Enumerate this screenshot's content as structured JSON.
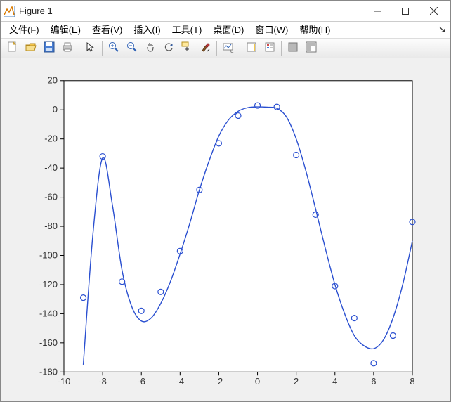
{
  "window": {
    "title": "Figure 1"
  },
  "menubar": [
    {
      "label": "文件",
      "mn": "F"
    },
    {
      "label": "编辑",
      "mn": "E"
    },
    {
      "label": "查看",
      "mn": "V"
    },
    {
      "label": "插入",
      "mn": "I"
    },
    {
      "label": "工具",
      "mn": "T"
    },
    {
      "label": "桌面",
      "mn": "D"
    },
    {
      "label": "窗口",
      "mn": "W"
    },
    {
      "label": "帮助",
      "mn": "H"
    }
  ],
  "toolbar": [
    {
      "name": "new",
      "kind": "new"
    },
    {
      "name": "open",
      "kind": "open"
    },
    {
      "name": "save",
      "kind": "save"
    },
    {
      "name": "print",
      "kind": "print"
    },
    {
      "sep": true
    },
    {
      "name": "pointer",
      "kind": "pointer"
    },
    {
      "sep": true
    },
    {
      "name": "zoom-in",
      "kind": "zoomin"
    },
    {
      "name": "zoom-out",
      "kind": "zoomout"
    },
    {
      "name": "pan",
      "kind": "pan"
    },
    {
      "name": "rotate",
      "kind": "rotate"
    },
    {
      "name": "data-cursor",
      "kind": "datacursor"
    },
    {
      "name": "brush",
      "kind": "brush"
    },
    {
      "sep": true
    },
    {
      "name": "link-plot",
      "kind": "link"
    },
    {
      "sep": true
    },
    {
      "name": "colorbar",
      "kind": "colorbar"
    },
    {
      "name": "legend",
      "kind": "legend"
    },
    {
      "sep": true
    },
    {
      "name": "dock",
      "kind": "dock"
    },
    {
      "name": "layout",
      "kind": "layout"
    }
  ],
  "chart_data": {
    "type": "line+scatter",
    "xlabel": "",
    "ylabel": "",
    "xlim": [
      -10,
      8
    ],
    "ylim": [
      -180,
      20
    ],
    "xticks": [
      -10,
      -8,
      -6,
      -4,
      -2,
      0,
      2,
      4,
      6,
      8
    ],
    "yticks": [
      -180,
      -160,
      -140,
      -120,
      -100,
      -80,
      -60,
      -40,
      -20,
      0,
      20
    ],
    "scatter": {
      "x": [
        -9,
        -8,
        -7,
        -6,
        -5,
        -4,
        -3,
        -2,
        -1,
        0,
        1,
        2,
        3,
        4,
        5,
        6,
        7,
        8
      ],
      "y": [
        -129,
        -32,
        -118,
        -138,
        -125,
        -97,
        -55,
        -23,
        -4,
        3,
        2,
        -31,
        -72,
        -121,
        -143,
        -174,
        -155,
        -77
      ]
    },
    "line": {
      "x": [
        -9,
        -8.5,
        -8,
        -7.5,
        -7,
        -6.5,
        -6,
        -5.5,
        -5,
        -4.5,
        -4,
        -3.5,
        -3,
        -2.5,
        -2,
        -1.5,
        -1,
        -0.5,
        0,
        0.5,
        1,
        1.5,
        2,
        2.5,
        3,
        3.5,
        4,
        4.5,
        5,
        5.5,
        6,
        6.5,
        7,
        7.5,
        8
      ],
      "y": [
        -175,
        -85,
        -33,
        -65,
        -110,
        -135,
        -145,
        -143,
        -133,
        -118,
        -99,
        -78,
        -55,
        -35,
        -18,
        -7,
        -1,
        1.5,
        2,
        1.8,
        1,
        -5,
        -20,
        -42,
        -68,
        -95,
        -120,
        -140,
        -155,
        -162,
        -164,
        -158,
        -143,
        -120,
        -90
      ]
    },
    "colors": {
      "axis": "#000000",
      "line": "#2a4fd0",
      "scatter": "#2a4fd0",
      "axes_bg": "#ffffff",
      "figure_bg": "#f0f0f0"
    }
  }
}
